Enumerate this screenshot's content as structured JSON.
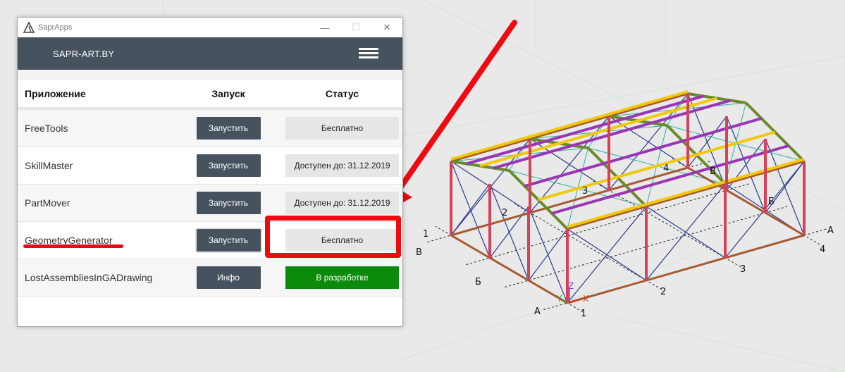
{
  "window": {
    "title": "SaprApps",
    "controls": {
      "minimize": "—",
      "maximize": "☐",
      "close": "✕"
    }
  },
  "header": {
    "brand": "SAPR-ART.BY",
    "menu_icon": "hamburger-menu-icon"
  },
  "table": {
    "columns": {
      "name": "Приложение",
      "launch": "Запуск",
      "status": "Статус"
    },
    "rows": [
      {
        "name": "FreeTools",
        "action": "Запустить",
        "status": "Бесплатно",
        "status_type": "neutral"
      },
      {
        "name": "SkillMaster",
        "action": "Запустить",
        "status": "Доступен до: 31.12.2019",
        "status_type": "neutral"
      },
      {
        "name": "PartMover",
        "action": "Запустить",
        "status": "Доступен до: 31.12.2019",
        "status_type": "neutral"
      },
      {
        "name": "GeometryGenerator",
        "action": "Запустить",
        "status": "Бесплатно",
        "status_type": "neutral"
      },
      {
        "name": "LostAssembliesInGADrawing",
        "action": "Инфо",
        "status": "В разработке",
        "status_type": "dev"
      }
    ]
  },
  "annotations": {
    "arrow_color": "#ee0a10",
    "underline_color": "#e8091b"
  },
  "model": {
    "axis_labels": {
      "x": "X",
      "y": "Y",
      "z": "Z"
    },
    "grid_labels": {
      "n1_front": "1",
      "n1_left": "1",
      "n2_front": "2",
      "n2_left": "2",
      "n3_front": "3",
      "n3_roof": "3",
      "n4_right": "4",
      "n4_roof": "4",
      "a_front": "А",
      "a_right": "А",
      "b_left": "Б",
      "b_right": "Б",
      "v_left": "В",
      "v_roof": "В"
    },
    "colors": {
      "column": "#d8405a",
      "frame": "#a65a30",
      "rafter": "#6b8a2c",
      "purlin_yellow": "#f2c90a",
      "purlin_purple": "#9a35b5",
      "brace": "#2a3c8c",
      "tie": "#2ab3a0"
    }
  }
}
